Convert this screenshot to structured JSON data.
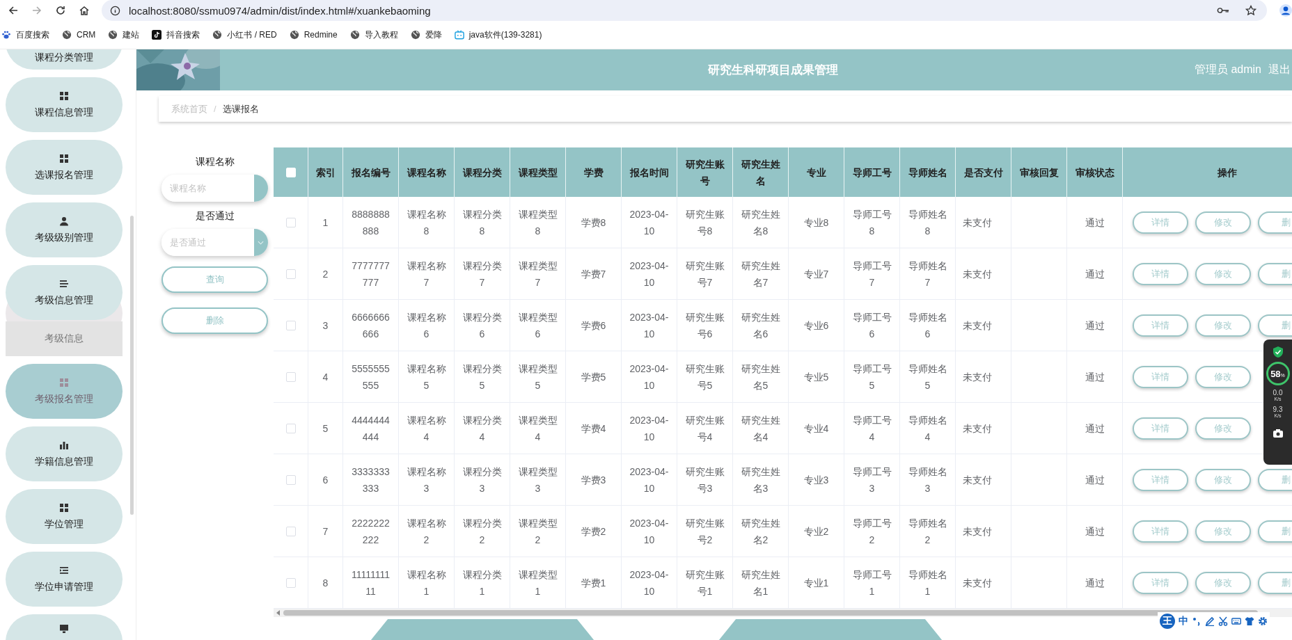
{
  "browser": {
    "url": "localhost:8080/ssmu0974/admin/dist/index.html#/xuankebaoming",
    "bookmarks": [
      {
        "label": "百度搜索",
        "kind": "paw"
      },
      {
        "label": "CRM",
        "kind": "globe"
      },
      {
        "label": "建站",
        "kind": "globe"
      },
      {
        "label": "抖音搜索",
        "kind": "note"
      },
      {
        "label": "小红书 / RED",
        "kind": "globe"
      },
      {
        "label": "Redmine",
        "kind": "globe"
      },
      {
        "label": "导入教程",
        "kind": "globe"
      },
      {
        "label": "爱降",
        "kind": "globe"
      },
      {
        "label": "java软件(139-3281)",
        "kind": "tv"
      }
    ]
  },
  "sidebar": {
    "items": [
      {
        "label": "课程分类管理",
        "selected": false,
        "expanded": false
      },
      {
        "label": "课程信息管理",
        "kind": "grid",
        "selected": false,
        "expanded": false
      },
      {
        "label": "选课报名管理",
        "kind": "grid",
        "selected": false,
        "expanded": false
      },
      {
        "label": "考级级别管理",
        "kind": "person",
        "selected": false,
        "expanded": false
      },
      {
        "label": "考级信息管理",
        "kind": "list",
        "selected": false,
        "expanded": true,
        "children": [
          {
            "label": "考级信息"
          }
        ]
      },
      {
        "label": "考级报名管理",
        "kind": "grid",
        "selected": true,
        "expanded": false
      },
      {
        "label": "学籍信息管理",
        "kind": "bars",
        "selected": false,
        "expanded": false
      },
      {
        "label": "学位管理",
        "kind": "grid",
        "selected": false,
        "expanded": false
      },
      {
        "label": "学位申请管理",
        "kind": "indent",
        "selected": false,
        "expanded": false
      },
      {
        "kind": "monitor",
        "selected": false,
        "expanded": false
      }
    ]
  },
  "header": {
    "title": "研究生科研项目成果管理",
    "user": "管理员 admin",
    "logout": "退出"
  },
  "breadcrumb": {
    "items": [
      "系统首页",
      "选课报名"
    ],
    "separator": "/"
  },
  "filters": {
    "fields": [
      {
        "kind": "input",
        "label": "课程名称",
        "placeholder": "课程名称"
      },
      {
        "kind": "select",
        "label": "是否通过",
        "placeholder": "是否通过"
      }
    ],
    "buttons": [
      "查询",
      "删除"
    ]
  },
  "table": {
    "all_checked": false,
    "columns": [
      "索引",
      "报名编号",
      "课程名称",
      "课程分类",
      "课程类型",
      "学费",
      "报名时间",
      "研究生账号",
      "研究生姓名",
      "专业",
      "导师工号",
      "导师姓名",
      "是否支付",
      "审核回复",
      "审核状态",
      "操作"
    ],
    "rows": [
      {
        "checked": false,
        "cells": [
          "1",
          "8888888888",
          "课程名称8",
          "课程分类8",
          "课程类型8",
          "学费8",
          "2023-04-10",
          "研究生账号8",
          "研究生姓名8",
          "专业8",
          "导师工号8",
          "导师姓名8",
          "未支付",
          "",
          "通过"
        ],
        "actions": [
          "详情",
          "修改",
          "删"
        ]
      },
      {
        "checked": false,
        "cells": [
          "2",
          "7777777777",
          "课程名称7",
          "课程分类7",
          "课程类型7",
          "学费7",
          "2023-04-10",
          "研究生账号7",
          "研究生姓名7",
          "专业7",
          "导师工号7",
          "导师姓名7",
          "未支付",
          "",
          "通过"
        ],
        "actions": [
          "详情",
          "修改",
          "删"
        ]
      },
      {
        "checked": false,
        "cells": [
          "3",
          "6666666666",
          "课程名称6",
          "课程分类6",
          "课程类型6",
          "学费6",
          "2023-04-10",
          "研究生账号6",
          "研究生姓名6",
          "专业6",
          "导师工号6",
          "导师姓名6",
          "未支付",
          "",
          "通过"
        ],
        "actions": [
          "详情",
          "修改",
          "删"
        ]
      },
      {
        "checked": false,
        "cells": [
          "4",
          "5555555555",
          "课程名称5",
          "课程分类5",
          "课程类型5",
          "学费5",
          "2023-04-10",
          "研究生账号5",
          "研究生姓名5",
          "专业5",
          "导师工号5",
          "导师姓名5",
          "未支付",
          "",
          "通过"
        ],
        "actions": [
          "详情",
          "修改"
        ]
      },
      {
        "checked": false,
        "cells": [
          "5",
          "4444444444",
          "课程名称4",
          "课程分类4",
          "课程类型4",
          "学费4",
          "2023-04-10",
          "研究生账号4",
          "研究生姓名4",
          "专业4",
          "导师工号4",
          "导师姓名4",
          "未支付",
          "",
          "通过"
        ],
        "actions": [
          "详情",
          "修改"
        ]
      },
      {
        "checked": false,
        "cells": [
          "6",
          "3333333333",
          "课程名称3",
          "课程分类3",
          "课程类型3",
          "学费3",
          "2023-04-10",
          "研究生账号3",
          "研究生姓名3",
          "专业3",
          "导师工号3",
          "导师姓名3",
          "未支付",
          "",
          "通过"
        ],
        "actions": [
          "详情",
          "修改",
          "删"
        ]
      },
      {
        "checked": false,
        "cells": [
          "7",
          "2222222222",
          "课程名称2",
          "课程分类2",
          "课程类型2",
          "学费2",
          "2023-04-10",
          "研究生账号2",
          "研究生姓名2",
          "专业2",
          "导师工号2",
          "导师姓名2",
          "未支付",
          "",
          "通过"
        ],
        "actions": [
          "详情",
          "修改",
          "删"
        ]
      },
      {
        "checked": false,
        "cells": [
          "8",
          "1111111111",
          "课程名称1",
          "课程分类1",
          "课程类型1",
          "学费1",
          "2023-04-10",
          "研究生账号1",
          "研究生姓名1",
          "专业1",
          "导师工号1",
          "导师姓名1",
          "未支付",
          "",
          "通过"
        ],
        "actions": [
          "详情",
          "修改",
          "删"
        ]
      }
    ]
  },
  "widget": {
    "cpu": "58",
    "cpu_unit": "%",
    "down": "0.0",
    "down_unit": "K/s",
    "up": "9.3",
    "up_unit": "K/s"
  },
  "ime": {
    "badge": "王",
    "mode": "中"
  }
}
